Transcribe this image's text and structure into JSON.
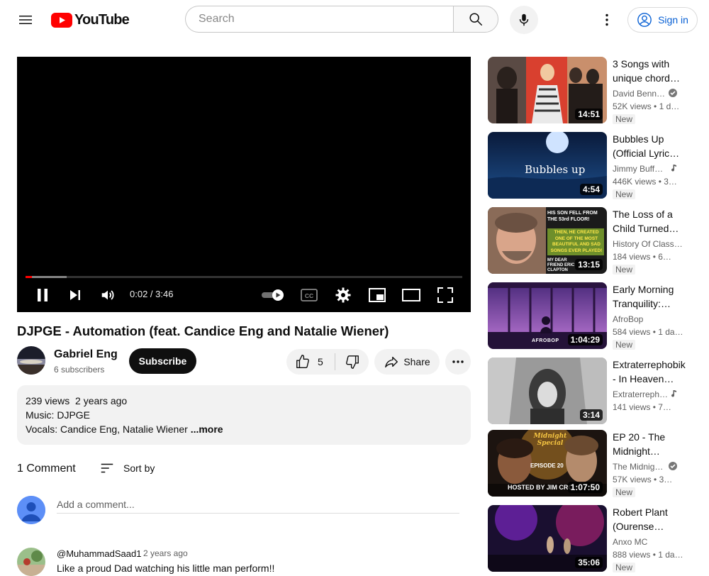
{
  "header": {
    "search_placeholder": "Search",
    "sign_in_label": "Sign in",
    "logo_text": "YouTube",
    "brand_red": "#FF0000"
  },
  "player": {
    "time_display": "0:02 / 3:46",
    "progress_played_fraction": 0.014,
    "progress_buffered_fraction": 0.094,
    "state": "playing",
    "autoplay": "on"
  },
  "video": {
    "title": "DJPGE - Automation (feat. Candice Eng and Natalie Wiener)",
    "channel_name": "Gabriel Eng",
    "subscribers": "6 subscribers",
    "subscribe_label": "Subscribe",
    "likes": "5",
    "share_label": "Share"
  },
  "description": {
    "meta": "239 views  2 years ago",
    "line1": "Music: DJPGE",
    "line2": "Vocals: Candice Eng, Natalie Wiener ",
    "more_label": "...more"
  },
  "comments": {
    "count": "1 Comment",
    "sort_label": "Sort by",
    "add_placeholder": "Add a comment...",
    "items": [
      {
        "author": "@MuhammadSaad1",
        "time": "2 years ago",
        "text": "Like a proud Dad watching his little man perform!!"
      }
    ]
  },
  "recommendations": [
    {
      "title": "3 Songs with unique chord…",
      "channel": "David Benn…",
      "verified": true,
      "music": false,
      "views": "52K views",
      "age": "1 d…",
      "duration": "14:51",
      "new_label": "New"
    },
    {
      "title": "Bubbles Up (Official Lyric…",
      "channel": "Jimmy Buff…",
      "verified": false,
      "music": true,
      "views": "446K views",
      "age": "3…",
      "duration": "4:54",
      "new_label": "New",
      "thumb_text": "Bubbles up"
    },
    {
      "title": "The Loss of a Child Turned…",
      "channel": "History Of Classi…",
      "verified": false,
      "music": false,
      "views": "184 views",
      "age": "6…",
      "duration": "13:15",
      "new_label": "New",
      "thumb_text": "HIS SON FELL FROM THE 53rd FLOOR!",
      "thumb_text2": "THEN, HE CREATED ONE OF THE MOST BEAUTIFUL AND SAD SONGS EVER PLAYED!",
      "thumb_text3": "MY DEAR FRIEND ERIC CLAPTON"
    },
    {
      "title": "Early Morning Tranquility:…",
      "channel": "AfroBop",
      "verified": false,
      "music": false,
      "views": "584 views",
      "age": "1 da…",
      "duration": "1:04:29",
      "new_label": "New",
      "thumb_text": "AFROBOP"
    },
    {
      "title": "Extraterrephobik - In Heaven…",
      "channel": "Extraterreph…",
      "verified": false,
      "music": true,
      "views": "141 views",
      "age": "7…",
      "duration": "3:14",
      "new_label": ""
    },
    {
      "title": "EP 20 - The Midnight…",
      "channel": "The Midnig…",
      "verified": true,
      "music": false,
      "views": "57K views",
      "age": "3…",
      "duration": "1:07:50",
      "new_label": "New",
      "thumb_text": "Midnight Special",
      "thumb_text2": "EPISODE 20",
      "thumb_text3": "HOSTED BY JIM CRC"
    },
    {
      "title": "Robert Plant (Ourense…",
      "channel": "Anxo MC",
      "verified": false,
      "music": false,
      "views": "888 views",
      "age": "1 da…",
      "duration": "35:06",
      "new_label": "New"
    }
  ],
  "colors": {
    "accent_blue": "#065FD4",
    "progress_red": "#FF0000",
    "chip_bg": "#F2F2F2"
  }
}
